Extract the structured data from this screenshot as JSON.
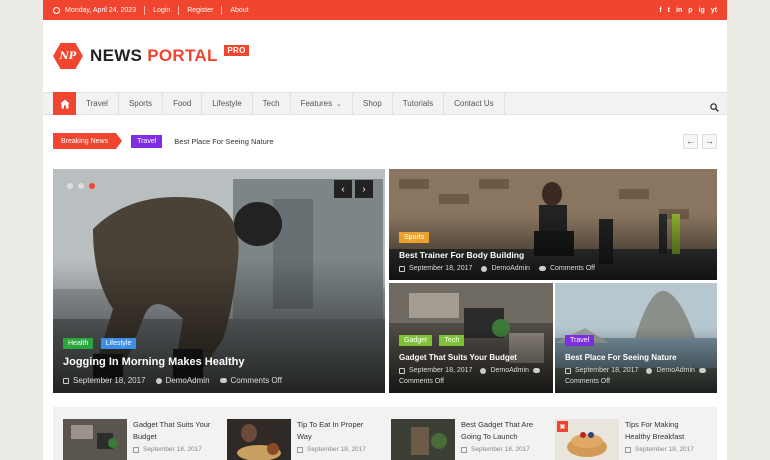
{
  "topbar": {
    "date": "Monday, April 24, 2023",
    "links": [
      "Login",
      "Register",
      "About"
    ],
    "social": [
      "f",
      "t",
      "in",
      "p",
      "ig",
      "yt"
    ]
  },
  "brand": {
    "name_a": "NEWS",
    "name_b": "PORTAL",
    "badge": "PRO",
    "logo_initials": "NP",
    "color": "#f0452e"
  },
  "nav": {
    "items": [
      "Travel",
      "Sports",
      "Food",
      "Lifestyle",
      "Tech",
      "Features",
      "Shop",
      "Tutorials",
      "Contact Us"
    ],
    "dropdown_item": "Features"
  },
  "ticker": {
    "label": "Breaking News",
    "category": "Travel",
    "headline": "Best Place For Seeing Nature",
    "prev": "←",
    "next": "→"
  },
  "slider": {
    "tags": [
      "Health",
      "Lifestyle"
    ],
    "title": "Jogging In Morning Makes Healthy",
    "date": "September 18, 2017",
    "author": "DemoAdmin",
    "comments": "Comments Off",
    "prev": "‹",
    "next": "›"
  },
  "cards": [
    {
      "tags": [
        "Sports"
      ],
      "title": "Best Trainer For Body Building",
      "date": "September 18, 2017",
      "author": "DemoAdmin",
      "comments": "Comments Off"
    },
    {
      "tags": [
        "Gadget",
        "Tech"
      ],
      "title": "Gadget That Suits Your Budget",
      "date": "September 18, 2017",
      "author": "DemoAdmin",
      "comments": "Comments Off"
    },
    {
      "tags": [
        "Travel"
      ],
      "title": "Best Place For Seeing Nature",
      "date": "September 18, 2017",
      "author": "DemoAdmin",
      "comments": "Comments Off"
    }
  ],
  "bottom": [
    {
      "title": "Gadget That Suits Your Budget",
      "date": "September 18, 2017"
    },
    {
      "title": "Tip To Eat In Proper Way",
      "date": "September 18, 2017"
    },
    {
      "title": "Best Gadget That Are Going To Launch",
      "date": "September 18, 2017"
    },
    {
      "title": "Tips For Making Healthy Breakfast",
      "date": "September 18, 2017"
    }
  ]
}
